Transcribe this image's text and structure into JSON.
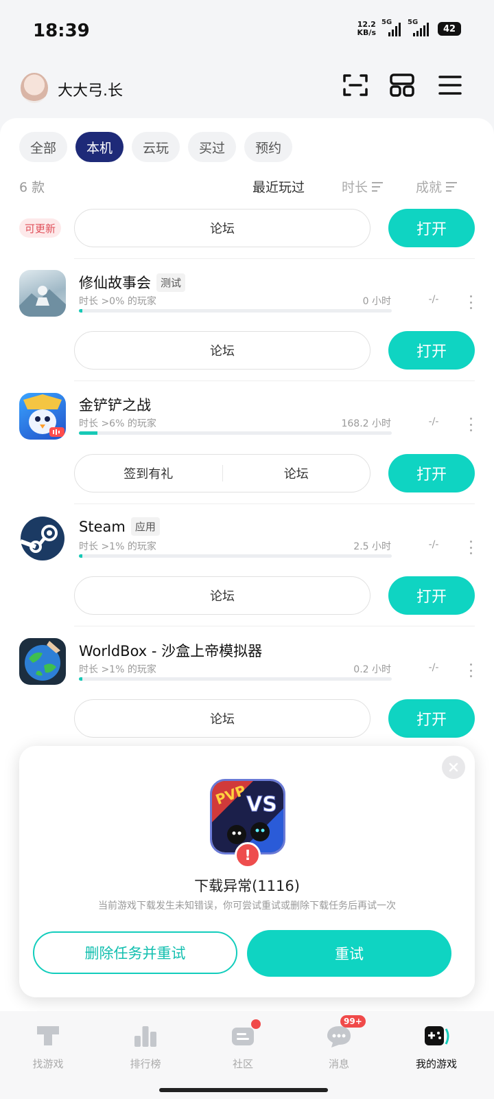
{
  "status_bar": {
    "time": "18:39",
    "net_speed_value": "12.2",
    "net_speed_unit": "KB/s",
    "signal1_label": "5G",
    "signal2_label": "5G",
    "battery": "42"
  },
  "header": {
    "username": "大大弓.长",
    "icons": [
      "scan-icon",
      "apps-grid-icon",
      "menu-icon"
    ]
  },
  "filters": [
    "全部",
    "本机",
    "云玩",
    "买过",
    "预约"
  ],
  "active_filter": "本机",
  "list_meta": {
    "count": "6 款",
    "sort_recent": "最近玩过",
    "sort_duration": "时长",
    "sort_achievement": "成就"
  },
  "first_item": {
    "update_tag": "可更新",
    "forum": "论坛",
    "open": "打开"
  },
  "games": [
    {
      "name": "修仙故事会",
      "tag": "测试",
      "stat_label": "时长 >0% 的玩家",
      "play_time": "0 小时",
      "progress": 0.01,
      "achievement": "-/-",
      "actions": [
        "论坛"
      ],
      "open": "打开"
    },
    {
      "name": "金铲铲之战",
      "tag": "",
      "stat_label": "时长 >6% 的玩家",
      "play_time": "168.2 小时",
      "progress": 0.06,
      "achievement": "-/-",
      "actions": [
        "签到有礼",
        "论坛"
      ],
      "open": "打开"
    },
    {
      "name": "Steam",
      "tag": "应用",
      "stat_label": "时长 >1% 的玩家",
      "play_time": "2.5 小时",
      "progress": 0.01,
      "achievement": "-/-",
      "actions": [
        "论坛"
      ],
      "open": "打开"
    },
    {
      "name": "WorldBox - 沙盒上帝模拟器",
      "tag": "",
      "stat_label": "时长 >1% 的玩家",
      "play_time": "0.2 小时",
      "progress": 0.01,
      "achievement": "-/-",
      "actions": [
        "论坛"
      ],
      "open": "打开"
    }
  ],
  "dialog": {
    "title": "下载异常(1116)",
    "description": "当前游戏下载发生未知错误，你可尝试重试或删除下载任务后再试一次",
    "delete_retry": "删除任务并重试",
    "retry": "重试",
    "icon_text_left": "PVP",
    "icon_text_right": "VS"
  },
  "tab_bar": {
    "items": [
      "找游戏",
      "排行榜",
      "社区",
      "消息",
      "我的游戏"
    ],
    "active": "我的游戏",
    "message_badge": "99+"
  },
  "colors": {
    "accent": "#0fd4c2",
    "active_filter_bg": "#1e2a78",
    "error": "#ee4d4d"
  }
}
